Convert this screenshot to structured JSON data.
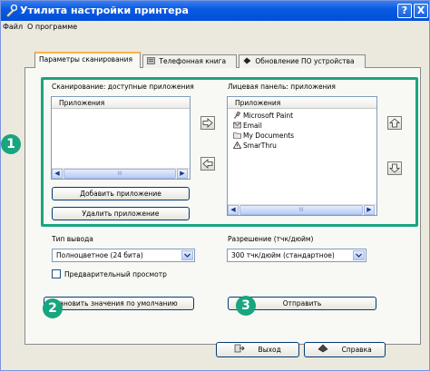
{
  "window": {
    "title": "Утилита настройки принтера",
    "help_button": "?",
    "close_button": "X"
  },
  "menu": {
    "items": [
      "Файл",
      "О программе"
    ]
  },
  "tabs": [
    {
      "label": "Параметры сканирования",
      "icon": "none"
    },
    {
      "label": "Телефонная книга",
      "icon": "phonebook-icon"
    },
    {
      "label": "Обновление ПО устройства",
      "icon": "firmware-icon"
    }
  ],
  "scan_apps": {
    "label": "Сканирование: доступные приложения",
    "list_header": "Приложения",
    "items": []
  },
  "front_panel": {
    "label": "Лицевая панель: приложения",
    "list_header": "Приложения",
    "items": [
      {
        "label": "Microsoft Paint",
        "icon": "paint-icon"
      },
      {
        "label": "Email",
        "icon": "email-icon"
      },
      {
        "label": "My Documents",
        "icon": "folder-icon"
      },
      {
        "label": "SmarThru",
        "icon": "smarthru-icon"
      }
    ]
  },
  "scroll_thumb_label": "III",
  "buttons": {
    "add_app": "Добавить приложение",
    "remove_app": "Удалить приложение",
    "defaults": "Установить значения по умолчанию",
    "send": "Отправить",
    "exit": "Выход",
    "help": "Справка"
  },
  "output_type": {
    "label": "Тип вывода",
    "value": "Полноцветное (24 бита)"
  },
  "resolution": {
    "label": "Разрешение (тчк/дюйм)",
    "value": "300 тчк/дюйм (стандартное)"
  },
  "preview": {
    "label": "Предварительный просмотр",
    "checked": false
  },
  "callouts": [
    "1",
    "2",
    "3"
  ],
  "colors": {
    "callout": "#18a57f",
    "titlebar": "#0a5ae0",
    "tab_accent": "#f7b446"
  }
}
